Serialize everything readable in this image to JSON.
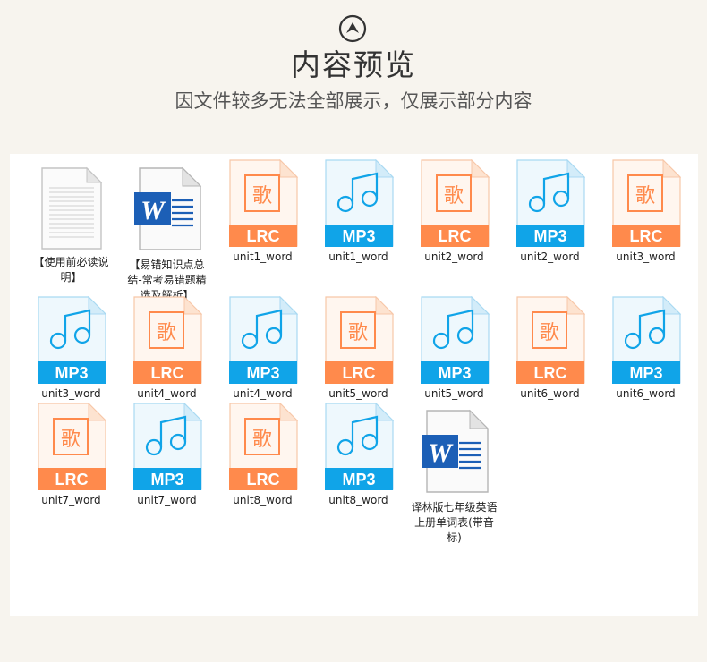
{
  "header": {
    "title": "内容预览",
    "subtitle": "因文件较多无法全部展示，仅展示部分内容",
    "icon": "chevron-up-circle-icon"
  },
  "colors": {
    "lrc": "#ff8a4c",
    "mp3": "#10a4e8",
    "word": "#1c5fb6"
  },
  "files": [
    {
      "type": "txt",
      "name": "【使用前必读说明】"
    },
    {
      "type": "word",
      "name": "【易错知识点总结-常考易错题精选及解析】"
    },
    {
      "type": "lrc",
      "name": "unit1_word",
      "badge": "LRC",
      "glyph": "歌"
    },
    {
      "type": "mp3",
      "name": "unit1_word",
      "badge": "MP3"
    },
    {
      "type": "lrc",
      "name": "unit2_word",
      "badge": "LRC",
      "glyph": "歌"
    },
    {
      "type": "mp3",
      "name": "unit2_word",
      "badge": "MP3"
    },
    {
      "type": "lrc",
      "name": "unit3_word",
      "badge": "LRC",
      "glyph": "歌"
    },
    {
      "type": "mp3",
      "name": "unit3_word",
      "badge": "MP3"
    },
    {
      "type": "lrc",
      "name": "unit4_word",
      "badge": "LRC",
      "glyph": "歌"
    },
    {
      "type": "mp3",
      "name": "unit4_word",
      "badge": "MP3"
    },
    {
      "type": "lrc",
      "name": "unit5_word",
      "badge": "LRC",
      "glyph": "歌"
    },
    {
      "type": "mp3",
      "name": "unit5_word",
      "badge": "MP3"
    },
    {
      "type": "lrc",
      "name": "unit6_word",
      "badge": "LRC",
      "glyph": "歌"
    },
    {
      "type": "mp3",
      "name": "unit6_word",
      "badge": "MP3"
    },
    {
      "type": "lrc",
      "name": "unit7_word",
      "badge": "LRC",
      "glyph": "歌"
    },
    {
      "type": "mp3",
      "name": "unit7_word",
      "badge": "MP3"
    },
    {
      "type": "lrc",
      "name": "unit8_word",
      "badge": "LRC",
      "glyph": "歌"
    },
    {
      "type": "mp3",
      "name": "unit8_word",
      "badge": "MP3"
    },
    {
      "type": "word",
      "name": "译林版七年级英语上册单词表(带音标)"
    }
  ]
}
